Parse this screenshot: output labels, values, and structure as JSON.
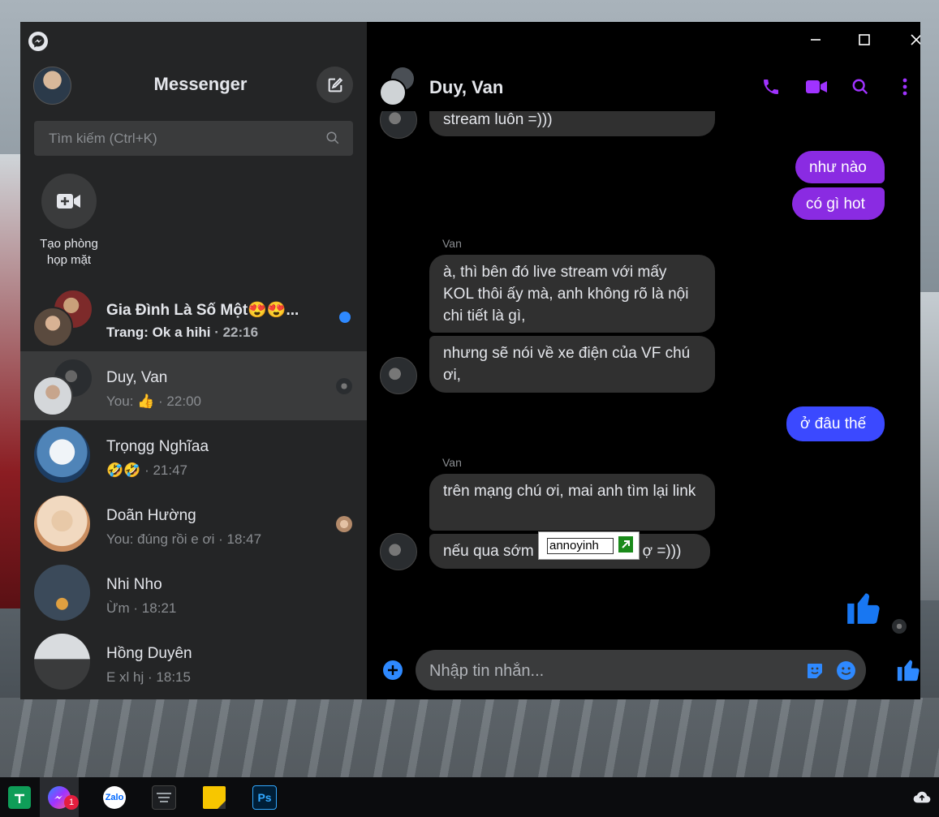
{
  "sidebar": {
    "app_title": "Messenger",
    "search_placeholder": "Tìm kiếm (Ctrl+K)",
    "room_label_line1": "Tạo phòng",
    "room_label_line2": "họp mặt",
    "conversations": [
      {
        "name": "Gia Đình Là Số Một😍😍...",
        "preview": "Trang: Ok a hihi",
        "time": "· 22:16",
        "unread": true
      },
      {
        "name": "Duy, Van",
        "preview": "You: 👍",
        "time": "· 22:00",
        "active": true
      },
      {
        "name": "Trọngg Nghĩaa",
        "preview": "🤣🤣",
        "time": "· 21:47"
      },
      {
        "name": "Doãn Hường",
        "preview": "You: đúng rồi e ơi",
        "time": "· 18:47"
      },
      {
        "name": "Nhi Nho",
        "preview": "Ừm",
        "time": "· 18:21"
      },
      {
        "name": "Hồng Duyên",
        "preview": "E xl hj",
        "time": "· 18:15"
      }
    ]
  },
  "chat": {
    "title": "Duy, Van",
    "accent_color": "#a033ff",
    "messages": [
      {
        "from": "other",
        "text": "stream luôn =)))"
      },
      {
        "from": "me",
        "text": "như nào"
      },
      {
        "from": "me",
        "text": "có gì hot"
      },
      {
        "sender": "Van"
      },
      {
        "from": "other",
        "text": "à, thì bên đó live stream với mấy KOL thôi ấy mà, anh không rõ là nội chi tiết là gì,"
      },
      {
        "from": "other",
        "text": "nhưng sẽ nói về xe điện của VF chú ơi,"
      },
      {
        "from": "me",
        "text": "ở đâu thế"
      },
      {
        "sender": "Van"
      },
      {
        "from": "other",
        "text": "trên mạng chú ơi, mai anh tìm lại link"
      },
      {
        "from": "other",
        "text_left": "nếu qua sớm",
        "text_right": "ú ợ =)))"
      }
    ],
    "sender_van_1": "Van",
    "sender_van_2": "Van",
    "composer_placeholder": "Nhập tin nhắn...",
    "overlay_text": "annoyinh"
  },
  "taskbar": {
    "messenger_badge": "1",
    "items": [
      "google-sheets",
      "messenger",
      "zalo",
      "gta-v",
      "sticky-notes",
      "photoshop"
    ],
    "zalo_label": "Zalo",
    "ps_label": "Ps"
  }
}
